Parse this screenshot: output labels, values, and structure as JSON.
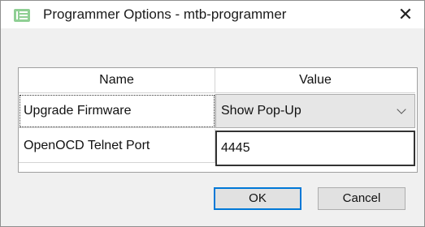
{
  "window": {
    "title": "Programmer Options - mtb-programmer",
    "close_glyph": "✕"
  },
  "table": {
    "headers": {
      "name": "Name",
      "value": "Value"
    },
    "rows": [
      {
        "name": "Upgrade Firmware",
        "value": "Show Pop-Up",
        "control": "select"
      },
      {
        "name": "OpenOCD Telnet Port",
        "value": "4445",
        "control": "input"
      }
    ]
  },
  "buttons": {
    "ok": "OK",
    "cancel": "Cancel"
  },
  "icons": {
    "app": "app-icon",
    "close": "close-icon",
    "dropdown": "chevron-down-icon"
  },
  "colors": {
    "accent": "#0078d7",
    "app_icon": "#8fcf94"
  }
}
